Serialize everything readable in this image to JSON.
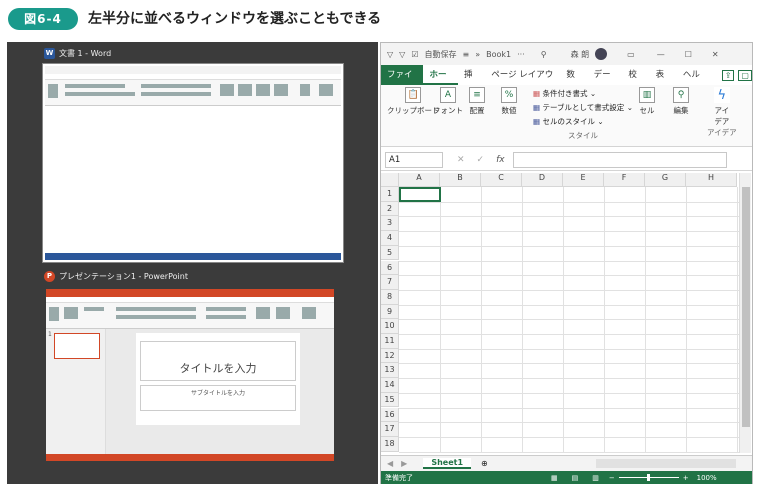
{
  "figure": {
    "badge": "図6-4",
    "caption": "左半分に並べるウィンドウを選ぶこともできる"
  },
  "word_window": {
    "app_icon": "word-icon",
    "title": "文書 1 - Word",
    "accent": "#2b579a"
  },
  "ppt_window": {
    "app_icon": "powerpoint-icon",
    "title": "プレゼンテーション1 - PowerPoint",
    "accent": "#d24726",
    "slide_title": "タイトルを入力",
    "slide_subtitle": "サブタイトルを入力",
    "slide_number": "1"
  },
  "excel": {
    "accent": "#217346",
    "titlebar": {
      "autosave": "自動保存",
      "filename": "Book1",
      "user": "森 朗"
    },
    "tabs": [
      "ファイル",
      "ホーム",
      "挿入",
      "ページ レイアウト",
      "数式",
      "データ",
      "校閲",
      "表示",
      "ヘルプ"
    ],
    "ribbon": {
      "clipboard": "クリップボード",
      "font": "フォント",
      "alignment": "配置",
      "number": "数値",
      "conditional": "条件付き書式",
      "table_format": "テーブルとして書式設定",
      "cell_style": "セルのスタイル",
      "style_group": "スタイル",
      "cells": "セル",
      "editing": "編集",
      "ideas": "アイ デア",
      "ideas_group": "アイデア"
    },
    "name_box": "A1",
    "fx": "fx",
    "columns": [
      "A",
      "B",
      "C",
      "D",
      "E",
      "F",
      "G",
      "H"
    ],
    "rows": [
      "1",
      "2",
      "3",
      "4",
      "5",
      "6",
      "7",
      "8",
      "9",
      "10",
      "11",
      "12",
      "13",
      "14",
      "15",
      "16",
      "17",
      "18"
    ],
    "sheet_tab": "Sheet1",
    "status": "準備完了",
    "zoom": "100%"
  }
}
